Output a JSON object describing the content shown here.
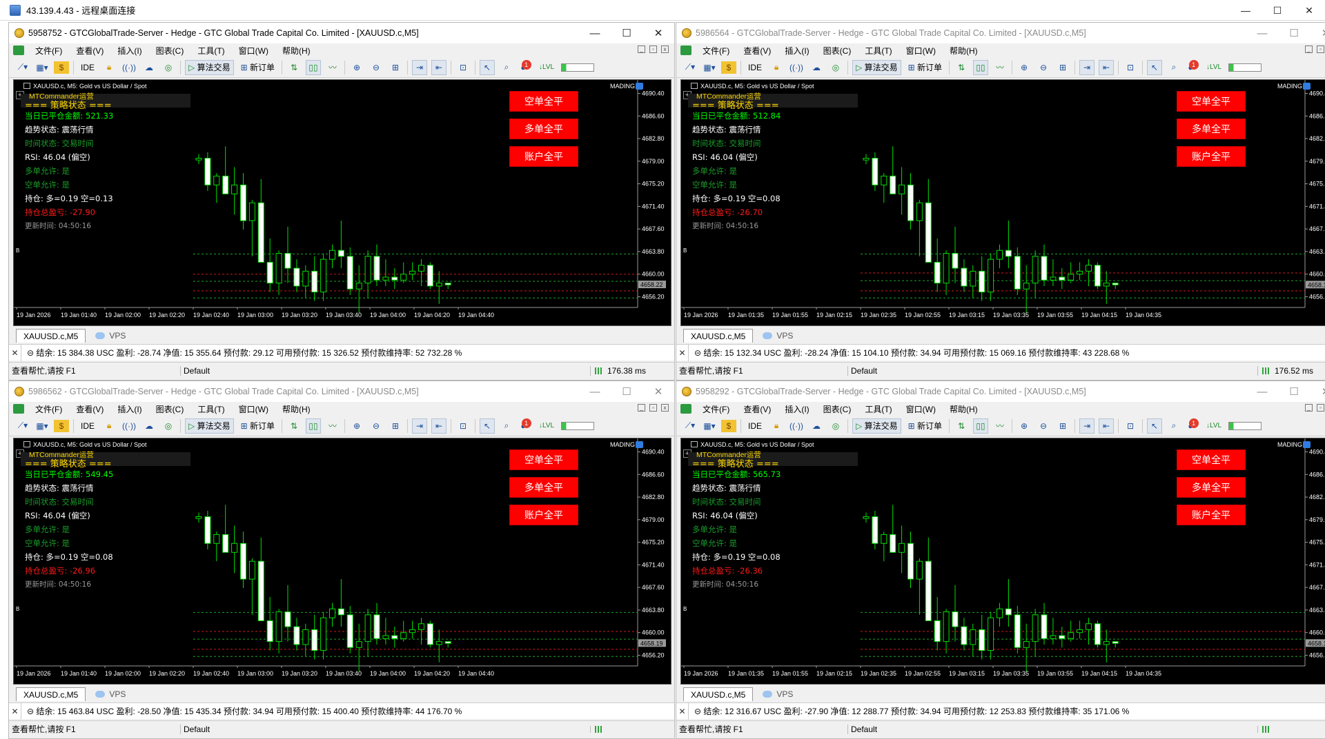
{
  "rdp": {
    "title": "43.139.4.43 - 远程桌面连接",
    "minimize": "—",
    "restore": "☐",
    "close": "✕"
  },
  "menu": [
    "文件(F)",
    "查看(V)",
    "插入(I)",
    "图表(C)",
    "工具(T)",
    "窗口(W)",
    "帮助(H)"
  ],
  "toolbar": {
    "ide": "IDE",
    "algo": "算法交易",
    "new_order": "新订单",
    "badge": "1"
  },
  "panel": {
    "ea": "MTCommander运营",
    "header": "=== 策略状态 ===",
    "trend": "趋势状态: 震荡行情",
    "time_state": "时间状态: 交易时间",
    "rsi": "RSI: 46.04 (偏空)",
    "long_allowed": "多单允许: 是",
    "short_allowed": "空单允许: 是",
    "update": "更新时间: 04:50:16"
  },
  "buttons": {
    "close_short": "空单全平",
    "close_long": "多单全平",
    "close_all": "账户全平"
  },
  "chart": {
    "symbol_line": "XAUUSD.c, M5:  Gold vs US Dollar / Spot",
    "mading": "MADING",
    "tab": "XAUUSD.c,M5",
    "vps": "VPS",
    "price_ticks": [
      "4690.40",
      "4686.60",
      "4682.80",
      "4679.00",
      "4675.20",
      "4671.40",
      "4667.60",
      "4663.80",
      "4660.00",
      "4656.20"
    ]
  },
  "status": {
    "help": "查看帮忙,请按 F1",
    "profile": "Default"
  },
  "chart_data": {
    "type": "candlestick",
    "ylim": [
      4654.4,
      4691.5
    ],
    "ohlc": [
      [
        4679.2,
        4680.2,
        4678.5,
        4679.5
      ],
      [
        4679.5,
        4680.5,
        4674.0,
        4675.0
      ],
      [
        4675.0,
        4677.0,
        4672.0,
        4676.5
      ],
      [
        4676.5,
        4681.5,
        4674.0,
        4673.5
      ],
      [
        4673.5,
        4678.0,
        4670.0,
        4675.0
      ],
      [
        4675.0,
        4677.0,
        4667.5,
        4669.0
      ],
      [
        4669.0,
        4672.5,
        4663.0,
        4672.0
      ],
      [
        4672.0,
        4676.0,
        4668.0,
        4662.0
      ],
      [
        4662.0,
        4666.0,
        4657.0,
        4658.5
      ],
      [
        4658.5,
        4664.0,
        4656.5,
        4663.5
      ],
      [
        4663.5,
        4668.0,
        4658.5,
        4661.0
      ],
      [
        4661.0,
        4662.5,
        4657.0,
        4658.0
      ],
      [
        4658.0,
        4661.5,
        4656.0,
        4660.5
      ],
      [
        4660.5,
        4663.0,
        4655.5,
        4657.0
      ],
      [
        4657.0,
        4663.5,
        4655.5,
        4662.5
      ],
      [
        4662.5,
        4665.0,
        4661.0,
        4664.0
      ],
      [
        4664.0,
        4669.0,
        4661.0,
        4663.0
      ],
      [
        4663.0,
        4664.5,
        4656.5,
        4657.5
      ],
      [
        4657.5,
        4661.5,
        4653.5,
        4658.5
      ],
      [
        4658.5,
        4664.0,
        4656.0,
        4663.0
      ],
      [
        4663.0,
        4665.0,
        4658.0,
        4659.0
      ],
      [
        4659.0,
        4662.5,
        4658.0,
        4659.5
      ],
      [
        4659.5,
        4661.0,
        4657.5,
        4659.0
      ],
      [
        4659.0,
        4662.0,
        4658.5,
        4660.0
      ],
      [
        4660.0,
        4662.0,
        4659.0,
        4660.5
      ],
      [
        4660.5,
        4662.5,
        4658.0,
        4661.5
      ],
      [
        4661.5,
        4662.0,
        4657.5,
        4658.0
      ],
      [
        4658.0,
        4660.5,
        4655.0,
        4658.5
      ],
      [
        4658.5,
        4658.5,
        4657.5,
        4658.2
      ]
    ],
    "x_labels": []
  },
  "terminals": [
    {
      "id": "t1",
      "inactive": false,
      "title": "5958752 - GTCGlobalTrade-Server - Hedge - GTC Global Trade Capital Co. Limited - [XAUUSD.c,M5]",
      "closed_today": "当日已平仓金额: 521.33",
      "position": "持仓: 多=0.19 空=0.13",
      "pnl": "持仓总盈亏: -27.90",
      "price_box": "4658.22",
      "x_labels": [
        "19 Jan 2026",
        "19 Jan 01:40",
        "19 Jan 02:00",
        "19 Jan 02:20",
        "19 Jan 02:40",
        "19 Jan 03:00",
        "19 Jan 03:20",
        "19 Jan 03:40",
        "19 Jan 04:00",
        "19 Jan 04:20",
        "19 Jan 04:40"
      ],
      "account": "结余: 15 384.38 USC  盈利: -28.74  净值: 15 355.64  预付款: 29.12  可用预付款: 15 326.52  预付款维持率: 52 732.28 %",
      "ping": "176.38 ms",
      "hlines": [
        4663.4,
        4660.0,
        4658.8,
        4657.2,
        4656.0
      ]
    },
    {
      "id": "t2",
      "inactive": true,
      "title": "5986564 - GTCGlobalTrade-Server - Hedge - GTC Global Trade Capital Co. Limited - [XAUUSD.c,M5]",
      "closed_today": "当日已平仓金额: 512.84",
      "position": "持仓: 多=0.19 空=0.08",
      "pnl": "持仓总盈亏: -26.70",
      "price_box": "4658.19",
      "x_labels": [
        "19 Jan 2026",
        "19 Jan 01:35",
        "19 Jan 01:55",
        "19 Jan 02:15",
        "19 Jan 02:35",
        "19 Jan 02:55",
        "19 Jan 03:15",
        "19 Jan 03:35",
        "19 Jan 03:55",
        "19 Jan 04:15",
        "19 Jan 04:35"
      ],
      "account": "结余: 15 132.34 USC  盈利: -28.24  净值: 15 104.10  预付款: 34.94  可用预付款: 15 069.16  预付款维持率: 43 228.68 %",
      "ping": "176.52 ms",
      "hlines": [
        4663.4,
        4660.2,
        4658.9,
        4657.2,
        4656.0
      ]
    },
    {
      "id": "t3",
      "inactive": true,
      "title": "5986562 - GTCGlobalTrade-Server - Hedge - GTC Global Trade Capital Co. Limited - [XAUUSD.c,M5]",
      "closed_today": "当日已平仓金额: 549.45",
      "position": "持仓: 多=0.19 空=0.08",
      "pnl": "持仓总盈亏: -26.96",
      "price_box": "4658.19",
      "x_labels": [
        "19 Jan 2026",
        "19 Jan 01:40",
        "19 Jan 02:00",
        "19 Jan 02:20",
        "19 Jan 02:40",
        "19 Jan 03:00",
        "19 Jan 03:20",
        "19 Jan 03:40",
        "19 Jan 04:00",
        "19 Jan 04:20",
        "19 Jan 04:40"
      ],
      "account": "结余: 15 463.84 USC  盈利: -28.50  净值: 15 435.34  预付款: 34.94  可用预付款: 15 400.40  预付款维持率: 44 176.70 %",
      "ping": "",
      "hlines": [
        4663.4,
        4660.2,
        4658.9,
        4657.2,
        4656.0
      ]
    },
    {
      "id": "t4",
      "inactive": true,
      "title": "5958292 - GTCGlobalTrade-Server - Hedge - GTC Global Trade Capital Co. Limited - [XAUUSD.c,M5]",
      "closed_today": "当日已平仓金额: 565.73",
      "position": "持仓: 多=0.19 空=0.08",
      "pnl": "持仓总盈亏: -26.36",
      "price_box": "4658.19",
      "x_labels": [
        "19 Jan 2026",
        "19 Jan 01:35",
        "19 Jan 01:55",
        "19 Jan 02:15",
        "19 Jan 02:35",
        "19 Jan 02:55",
        "19 Jan 03:15",
        "19 Jan 03:35",
        "19 Jan 03:55",
        "19 Jan 04:15",
        "19 Jan 04:35"
      ],
      "account": "结余: 12 316.67 USC  盈利: -27.90  净值: 12 288.77  预付款: 34.94  可用预付款: 12 253.83  预付款维持率: 35 171.06 %",
      "ping": "",
      "hlines": [
        4663.4,
        4660.2,
        4658.9,
        4657.2,
        4656.0
      ]
    }
  ]
}
